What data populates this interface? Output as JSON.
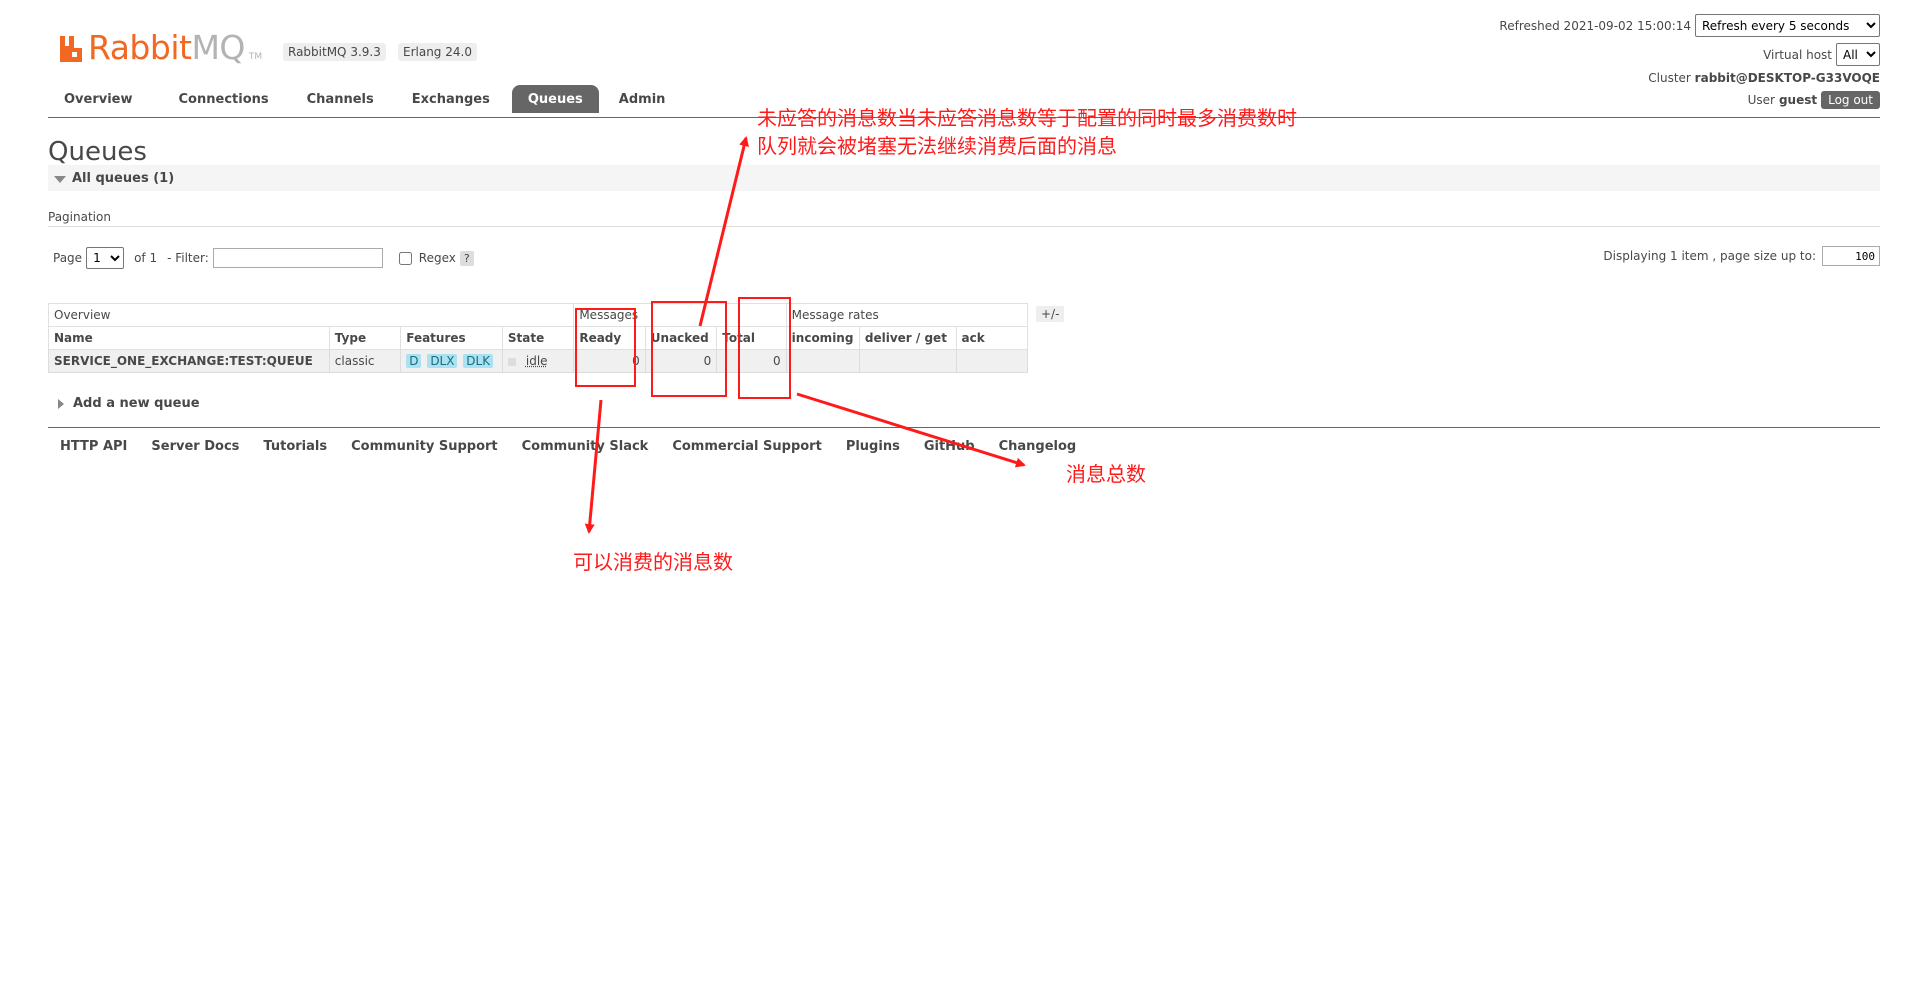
{
  "app": {
    "logo_rabbit": "Rabbit",
    "logo_mq": "MQ",
    "logo_tm": "TM",
    "version": "RabbitMQ 3.9.3",
    "erlang": "Erlang 24.0"
  },
  "header": {
    "refreshed_label": "Refreshed 2021-09-02 15:00:14",
    "refresh_select_value": "Refresh every 5 seconds",
    "vhost_label": "Virtual host",
    "vhost_select_value": "All",
    "cluster_label": "Cluster",
    "cluster_value": "rabbit@DESKTOP-G33VOQE",
    "user_label": "User",
    "user_value": "guest",
    "logout_label": "Log out"
  },
  "nav": {
    "tabs": [
      {
        "label": "Overview"
      },
      {
        "label": "Connections"
      },
      {
        "label": "Channels"
      },
      {
        "label": "Exchanges"
      },
      {
        "label": "Queues",
        "active": true
      },
      {
        "label": "Admin"
      }
    ]
  },
  "page": {
    "title": "Queues",
    "section_title": "All queues (1)",
    "pagination_label": "Pagination",
    "page_label": "Page",
    "page_select_value": "1",
    "of_label": "of 1",
    "filter_label": "- Filter:",
    "filter_value": "",
    "regex_label": "Regex",
    "help_label": "?",
    "displaying_label": "Displaying 1 item , page size up to:",
    "page_size_value": "100"
  },
  "table": {
    "groups": {
      "overview": "Overview",
      "messages": "Messages",
      "message_rates": "Message rates"
    },
    "columns": {
      "name": "Name",
      "type": "Type",
      "features": "Features",
      "state": "State",
      "ready": "Ready",
      "unacked": "Unacked",
      "total": "Total",
      "incoming": "incoming",
      "deliver_get": "deliver / get",
      "ack": "ack"
    },
    "row": {
      "name": "SERVICE_ONE_EXCHANGE:TEST:QUEUE",
      "type": "classic",
      "features": [
        "D",
        "DLX",
        "DLK"
      ],
      "state": "idle",
      "ready": "0",
      "unacked": "0",
      "total": "0",
      "incoming": "",
      "deliver_get": "",
      "ack": ""
    },
    "plus_minus": "+/-"
  },
  "add_queue_label": "Add a new queue",
  "footer": {
    "links": [
      "HTTP API",
      "Server Docs",
      "Tutorials",
      "Community Support",
      "Community Slack",
      "Commercial Support",
      "Plugins",
      "GitHub",
      "Changelog"
    ]
  },
  "annotations": {
    "unacked_note_line1": "未应答的消息数当未应答消息数等于配置的同时最多消费数时",
    "unacked_note_line2": "队列就会被堵塞无法继续消费后面的消息",
    "total_note": "消息总数",
    "ready_note": "可以消费的消息数",
    "color": "#ff1a1a"
  },
  "colors": {
    "brand_orange": "#f26822",
    "logo_grey": "#b3b3b3",
    "nav_active_bg": "#666666",
    "feature_pill_bg": "#aae2f2"
  }
}
